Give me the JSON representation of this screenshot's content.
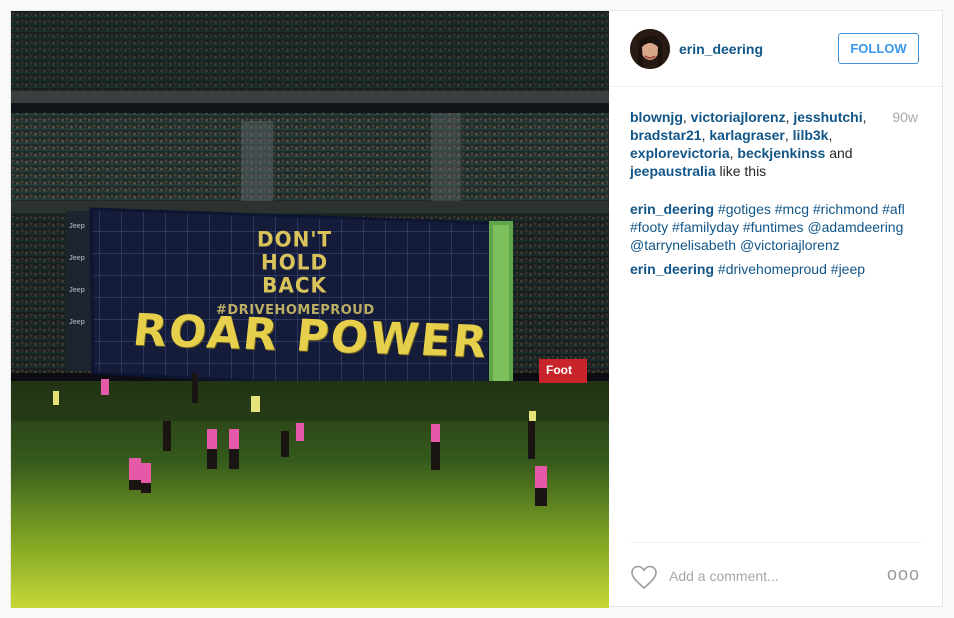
{
  "post": {
    "image_alt": "",
    "banner": {
      "line1": "DON'T",
      "line2": "HOLD",
      "line3": "BACK",
      "hashtag": "#DRIVEHOMEPROUD",
      "headline": "ROAR POWER",
      "sponsor_sign": "Foot",
      "jeep_logo": "Jeep"
    }
  },
  "author": {
    "username": "erin_deering",
    "avatar_icon": "avatar-photo"
  },
  "follow_label": "FOLLOW",
  "likes": {
    "users": [
      "blownjg",
      "victoriajlorenz",
      "jesshutchi",
      "bradstar21",
      "karlagraser",
      "lilb3k",
      "explorevictoria",
      "beckjenkinss",
      "jeepaustralia"
    ],
    "and_text": "and",
    "suffix": "like this",
    "age": "90w"
  },
  "comments": [
    {
      "user": "erin_deering",
      "tags": [
        "#gotiges",
        "#mcg",
        "#richmond",
        "#afl",
        "#footy",
        "#familyday",
        "#funtimes",
        "@adamdeering",
        "@tarrynelisabeth",
        "@victoriajlorenz"
      ]
    },
    {
      "user": "erin_deering",
      "tags": [
        "#drivehomeproud",
        "#jeep"
      ]
    }
  ],
  "add_comment": {
    "placeholder": "Add a comment...",
    "like_icon": "heart-icon",
    "more_icon": "more-options-icon",
    "more_glyph": "ooo"
  },
  "colors": {
    "link": "#125688",
    "follow": "#3897f0",
    "muted": "#a5a7aa"
  }
}
